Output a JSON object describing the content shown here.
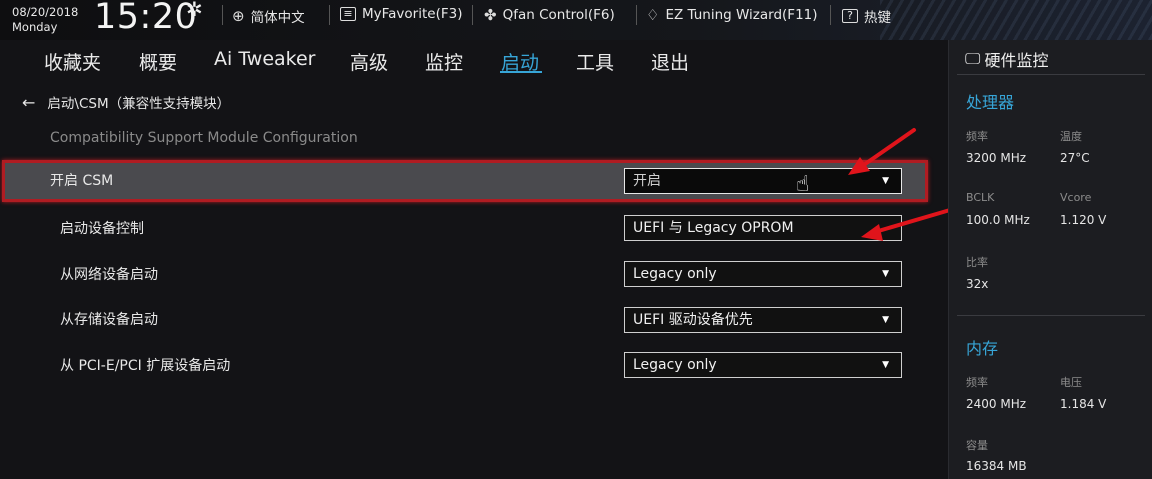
{
  "topbar": {
    "date": "08/20/2018",
    "day": "Monday",
    "time": "15:20",
    "settings_icon": "gear-icon",
    "items": [
      {
        "icon": "globe-icon",
        "label": "简体中文"
      },
      {
        "icon": "favorite-box-icon",
        "label": "MyFavorite(F3)"
      },
      {
        "icon": "fan-icon",
        "label": "Qfan Control(F6)"
      },
      {
        "icon": "bulb-icon",
        "label": "EZ Tuning Wizard(F11)"
      },
      {
        "icon": "help-box-icon",
        "label": "热键"
      }
    ]
  },
  "nav": {
    "tabs": [
      "收藏夹",
      "概要",
      "Ai Tweaker",
      "高级",
      "监控",
      "启动",
      "工具",
      "退出"
    ],
    "active": "启动"
  },
  "main": {
    "breadcrumb": "启动\\CSM（兼容性支持模块）",
    "subtitle": "Compatibility Support Module Configuration",
    "settings": [
      {
        "label": "开启 CSM",
        "value": "开启"
      },
      {
        "label": "启动设备控制",
        "value": "UEFI 与 Legacy OPROM"
      },
      {
        "label": "从网络设备启动",
        "value": "Legacy only"
      },
      {
        "label": "从存储设备启动",
        "value": "UEFI 驱动设备优先"
      },
      {
        "label": "从 PCI-E/PCI 扩展设备启动",
        "value": "Legacy only"
      }
    ]
  },
  "hw_monitor": {
    "title": "硬件监控",
    "cpu": {
      "section": "处理器",
      "freq_label": "频率",
      "freq": "3200 MHz",
      "temp_label": "温度",
      "temp": "27°C",
      "bclk_label": "BCLK",
      "bclk": "100.0 MHz",
      "vcore_label": "Vcore",
      "vcore": "1.120 V",
      "ratio_label": "比率",
      "ratio": "32x"
    },
    "memory": {
      "section": "内存",
      "freq_label": "频率",
      "freq": "2400 MHz",
      "volt_label": "电压",
      "volt": "1.184 V",
      "cap_label": "容量",
      "cap": "16384 MB"
    }
  },
  "colors": {
    "accent": "#37a5d7",
    "highlight_border": "#b01c22",
    "arrow": "#e0141b"
  }
}
